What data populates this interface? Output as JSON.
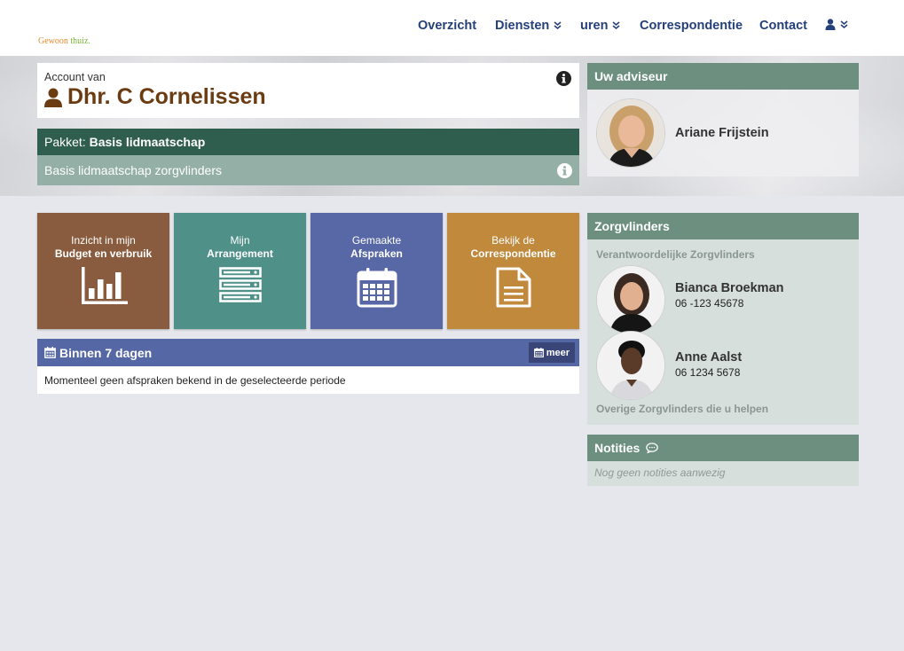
{
  "logo": {
    "part1": "Gewoon ",
    "part2": "thuiz."
  },
  "nav": {
    "overzicht": "Overzicht",
    "diensten": "Diensten",
    "uren": "uren",
    "correspondentie": "Correspondentie",
    "contact": "Contact"
  },
  "account": {
    "label": "Account van",
    "name": "Dhr. C Cornelissen"
  },
  "package": {
    "label": "Pakket:",
    "name": "Basis lidmaatschap",
    "description": "Basis lidmaatschap zorgvlinders"
  },
  "advisor": {
    "title": "Uw adviseur",
    "name": "Ariane Frijstein"
  },
  "tiles": [
    {
      "line1": "Inzicht in mijn",
      "line2": "Budget en verbruik",
      "color": "#8a5c3f",
      "icon": "bar-chart-icon"
    },
    {
      "line1": "Mijn",
      "line2": "Arrangement",
      "color": "#4f9089",
      "icon": "server-list-icon"
    },
    {
      "line1": "Gemaakte",
      "line2": "Afspraken",
      "color": "#5867a6",
      "icon": "calendar-icon"
    },
    {
      "line1": "Bekijk de",
      "line2": "Correspondentie",
      "color": "#c0893c",
      "icon": "document-icon"
    }
  ],
  "appointments": {
    "title": "Binnen 7 dagen",
    "more_label": "meer",
    "empty_text": "Momenteel geen afspraken bekend in de geselecteerde periode"
  },
  "zorgvlinders": {
    "title": "Zorgvlinders",
    "responsible_label": "Verantwoordelijke Zorgvlinders",
    "people": [
      {
        "name": "Bianca Broekman",
        "phone": "06 -123 45678"
      },
      {
        "name": "Anne Aalst",
        "phone": "06 1234 5678"
      }
    ],
    "others_label": "Overige Zorgvlinders die u helpen"
  },
  "notes": {
    "title": "Notities",
    "empty_text": "Nog geen notities aanwezig"
  },
  "colors": {
    "nav_text": "#25407a",
    "account_name": "#6b3c12",
    "package_head": "#2f5e4f",
    "package_body": "#94afa5",
    "side_head": "#6c8f80",
    "appointments_head": "#5667a5"
  }
}
